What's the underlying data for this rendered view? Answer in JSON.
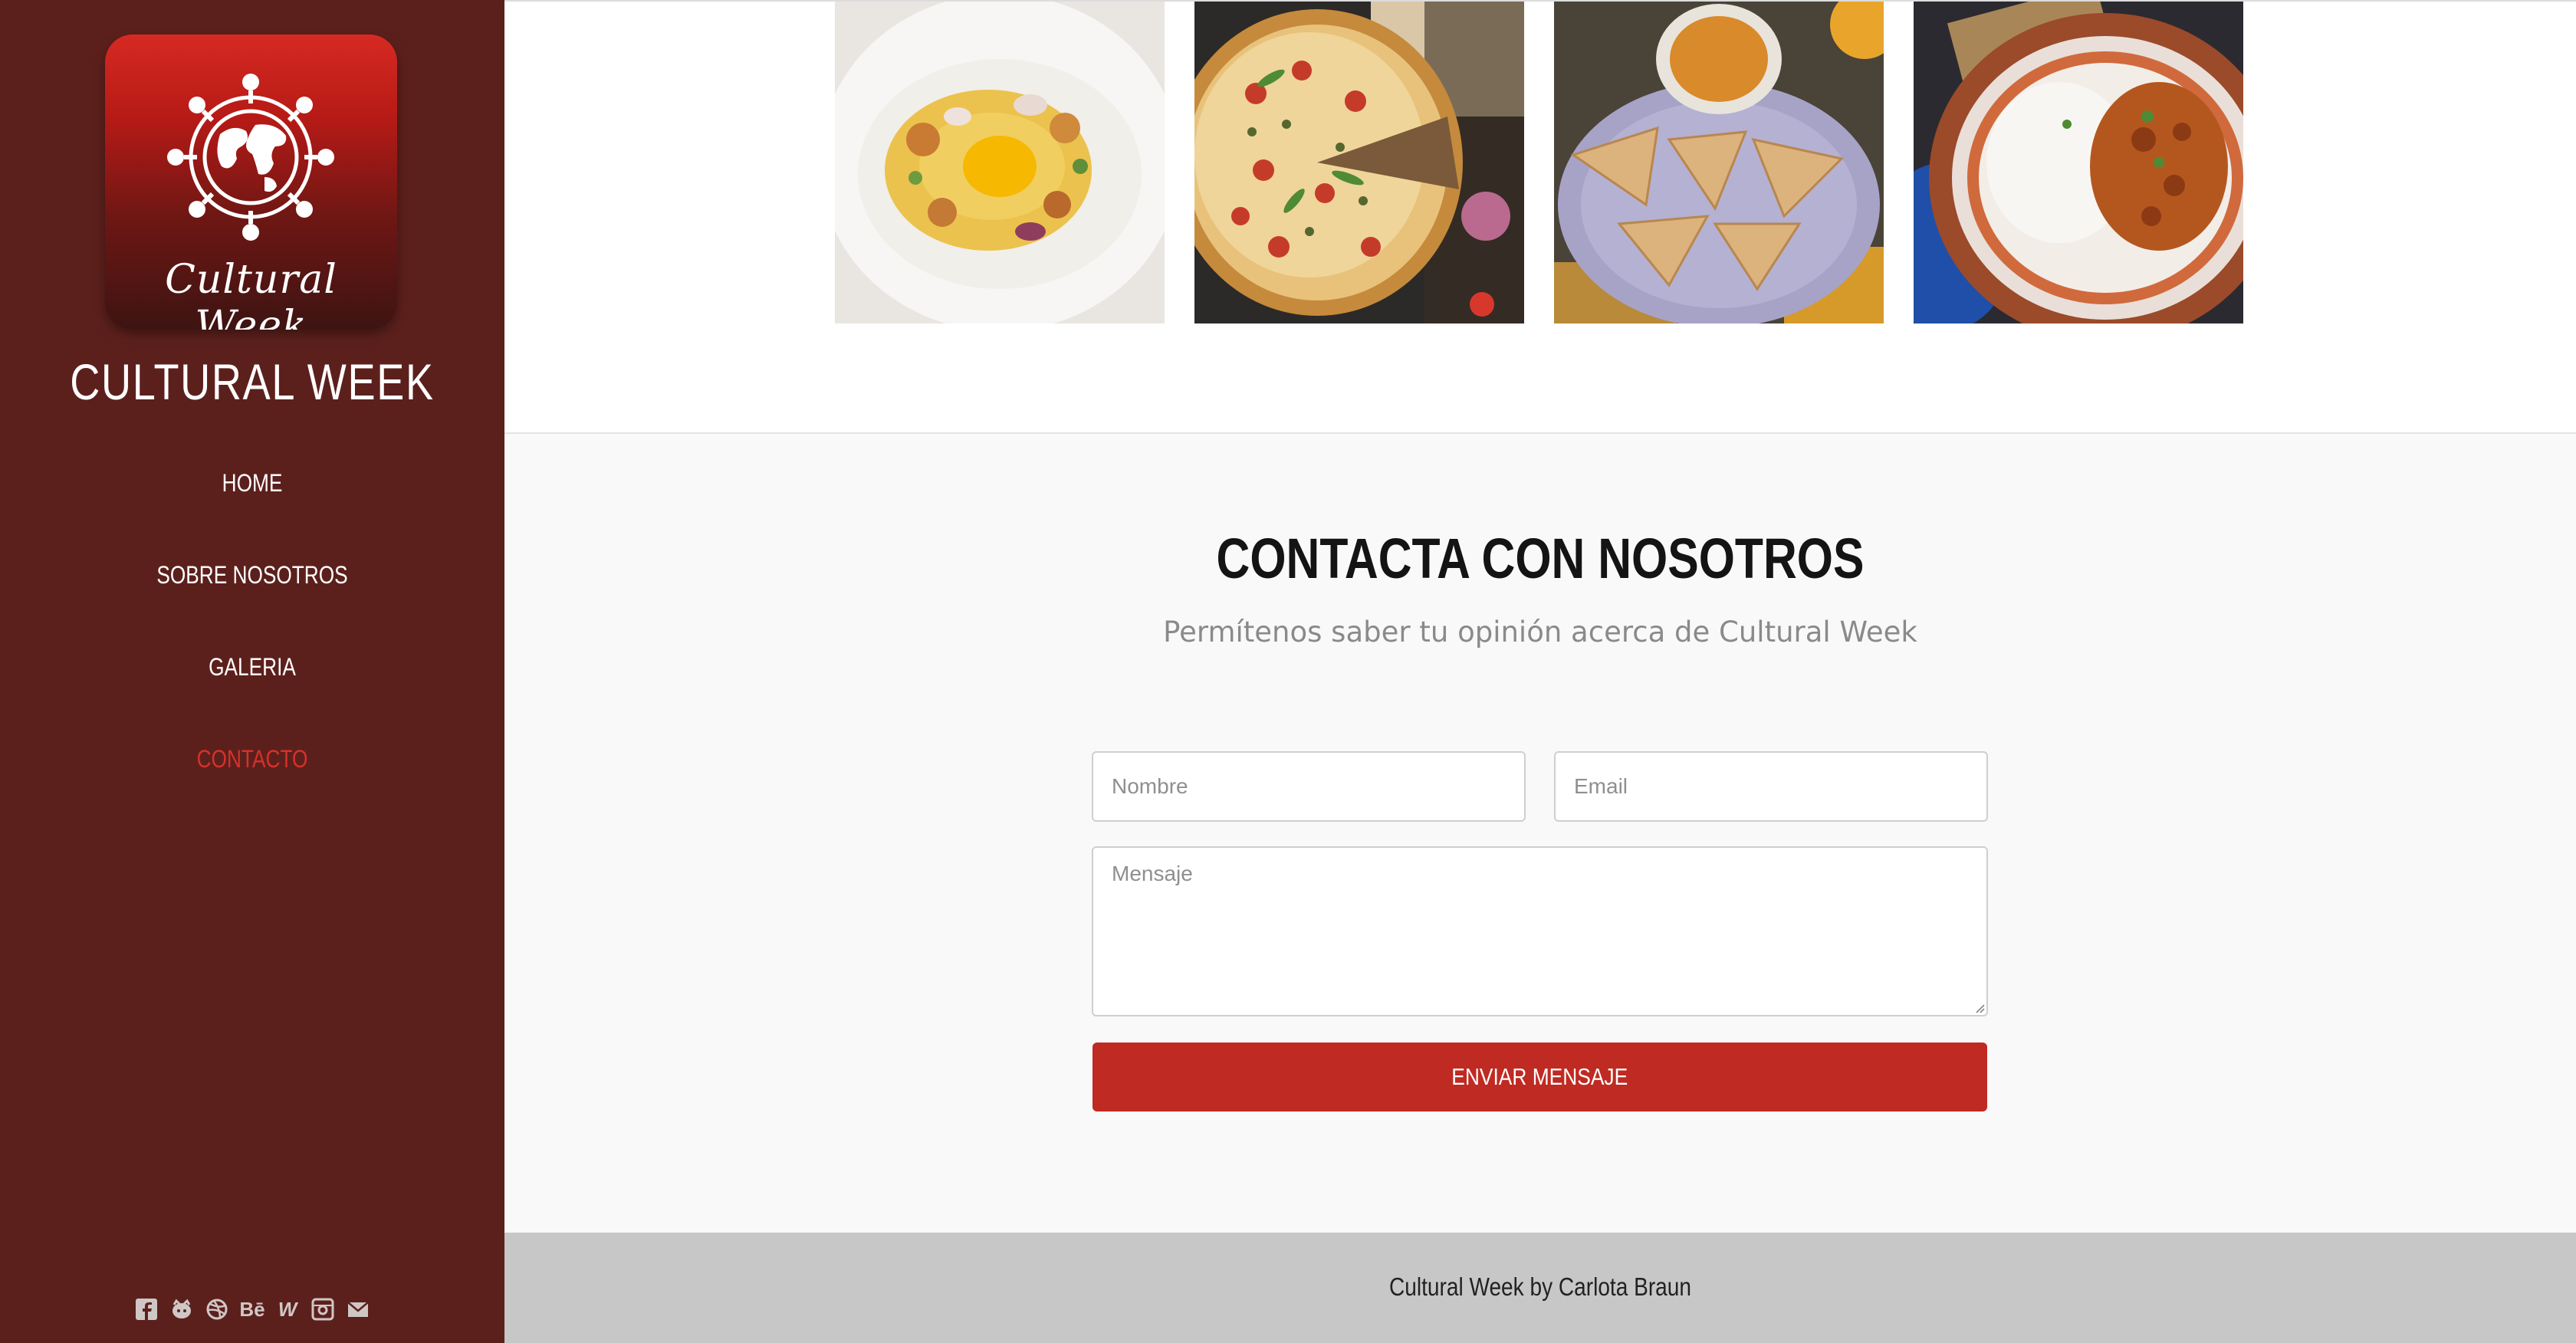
{
  "sidebar": {
    "logo_script": "Cultural Week",
    "brand_title": "CULTURAL WEEK",
    "nav": [
      {
        "label": "HOME",
        "active": false
      },
      {
        "label": "SOBRE NOSOTROS",
        "active": false
      },
      {
        "label": "GALERIA",
        "active": false
      },
      {
        "label": "CONTACTO",
        "active": true
      }
    ],
    "social": [
      {
        "icon": "facebook-icon",
        "glyph": "f"
      },
      {
        "icon": "github-icon",
        "glyph": ""
      },
      {
        "icon": "dribbble-icon",
        "glyph": ""
      },
      {
        "icon": "behance-icon",
        "glyph": "Bē"
      },
      {
        "icon": "w-icon",
        "glyph": "W"
      },
      {
        "icon": "instagram-icon",
        "glyph": ""
      },
      {
        "icon": "mail-icon",
        "glyph": ""
      }
    ]
  },
  "gallery": {
    "images": [
      {
        "name": "pasta-dish-image"
      },
      {
        "name": "pizza-image"
      },
      {
        "name": "scones-image"
      },
      {
        "name": "curry-rice-image"
      }
    ]
  },
  "contact": {
    "title": "CONTACTA CON NOSOTROS",
    "subtitle": "Permítenos saber tu opinión acerca de Cultural Week",
    "name_placeholder": "Nombre",
    "email_placeholder": "Email",
    "message_placeholder": "Mensaje",
    "send_label": "ENVIAR MENSAJE"
  },
  "footer": {
    "text": "Cultural Week by Carlota Braun"
  },
  "colors": {
    "sidebar_bg": "#5c201c",
    "accent": "#bf2a22",
    "active_nav": "#d6312a"
  }
}
